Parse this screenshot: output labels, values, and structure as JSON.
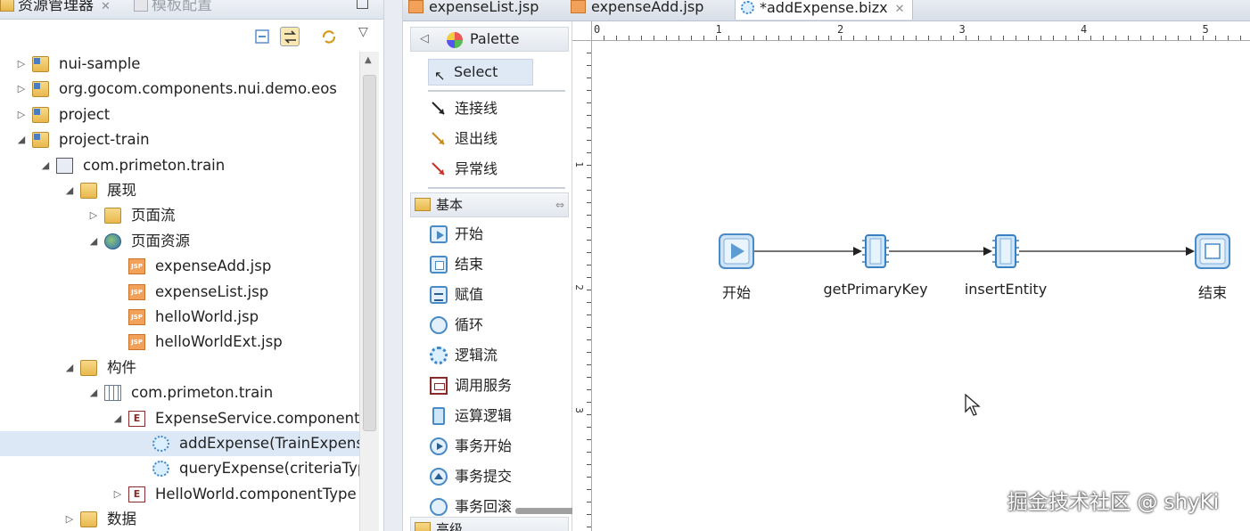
{
  "explorer": {
    "tabs": [
      {
        "label": "资源管理器",
        "icon": "explorer-icon"
      },
      {
        "label": "模板配置",
        "icon": "template-icon"
      }
    ],
    "tree": [
      {
        "label": "nui-sample",
        "depth": 0,
        "twisty": "collapsed",
        "icon": "project-icon"
      },
      {
        "label": "org.gocom.components.nui.demo.eos",
        "depth": 0,
        "twisty": "collapsed",
        "icon": "project-icon"
      },
      {
        "label": "project",
        "depth": 0,
        "twisty": "collapsed",
        "icon": "project-icon"
      },
      {
        "label": "project-train",
        "depth": 0,
        "twisty": "expanded",
        "icon": "project-icon"
      },
      {
        "label": "com.primeton.train",
        "depth": 1,
        "twisty": "expanded",
        "icon": "package-icon"
      },
      {
        "label": "展现",
        "depth": 2,
        "twisty": "expanded",
        "icon": "folder-icon"
      },
      {
        "label": "页面流",
        "depth": 3,
        "twisty": "collapsed",
        "icon": "folder-icon"
      },
      {
        "label": "页面资源",
        "depth": 3,
        "twisty": "expanded",
        "icon": "globe-icon"
      },
      {
        "label": "expenseAdd.jsp",
        "depth": 4,
        "twisty": "none",
        "icon": "jsp-icon"
      },
      {
        "label": "expenseList.jsp",
        "depth": 4,
        "twisty": "none",
        "icon": "jsp-icon"
      },
      {
        "label": "helloWorld.jsp",
        "depth": 4,
        "twisty": "none",
        "icon": "jsp-icon"
      },
      {
        "label": "helloWorldExt.jsp",
        "depth": 4,
        "twisty": "none",
        "icon": "jsp-icon"
      },
      {
        "label": "构件",
        "depth": 2,
        "twisty": "expanded",
        "icon": "folder-icon"
      },
      {
        "label": "com.primeton.train",
        "depth": 3,
        "twisty": "expanded",
        "icon": "grid-icon"
      },
      {
        "label": "ExpenseService.componentT",
        "depth": 4,
        "twisty": "expanded",
        "icon": "component-icon"
      },
      {
        "label": "addExpense(TrainExpens",
        "depth": 5,
        "twisty": "none",
        "icon": "logic-flow-icon",
        "selected": true
      },
      {
        "label": "queryExpense(criteriaTyp",
        "depth": 5,
        "twisty": "none",
        "icon": "logic-flow-icon"
      },
      {
        "label": "HelloWorld.componentType",
        "depth": 4,
        "twisty": "collapsed",
        "icon": "component-icon"
      },
      {
        "label": "数据",
        "depth": 2,
        "twisty": "collapsed",
        "icon": "folder-icon"
      }
    ]
  },
  "editor": {
    "tabs": [
      {
        "label": "expenseList.jsp",
        "active": false
      },
      {
        "label": "expenseAdd.jsp",
        "active": false
      },
      {
        "label": "*addExpense.bizx",
        "active": true
      }
    ]
  },
  "palette": {
    "title": "Palette",
    "select_label": "Select",
    "lines": [
      {
        "label": "连接线",
        "icon": "connection-line-icon"
      },
      {
        "label": "退出线",
        "icon": "exit-line-icon"
      },
      {
        "label": "异常线",
        "icon": "exception-line-icon"
      }
    ],
    "basic_group": "基本",
    "basic_items": [
      {
        "label": "开始",
        "icon": "start-node-icon"
      },
      {
        "label": "结束",
        "icon": "end-node-icon"
      },
      {
        "label": "赋值",
        "icon": "assign-icon"
      },
      {
        "label": "循环",
        "icon": "loop-icon"
      },
      {
        "label": "逻辑流",
        "icon": "logic-flow-icon"
      },
      {
        "label": "调用服务",
        "icon": "invoke-service-icon"
      },
      {
        "label": "运算逻辑",
        "icon": "operation-logic-icon"
      },
      {
        "label": "事务开始",
        "icon": "transaction-begin-icon"
      },
      {
        "label": "事务提交",
        "icon": "transaction-commit-icon"
      },
      {
        "label": "事务回滚",
        "icon": "transaction-rollback-icon"
      }
    ],
    "advanced_group": "高级"
  },
  "canvas": {
    "ruler_top": [
      "0",
      "1",
      "2",
      "3",
      "4",
      "5"
    ],
    "ruler_left": [
      "1",
      "2",
      "3"
    ],
    "nodes": [
      {
        "label": "开始",
        "type": "start"
      },
      {
        "label": "getPrimaryKey",
        "type": "operation"
      },
      {
        "label": "insertEntity",
        "type": "operation"
      },
      {
        "label": "结束",
        "type": "end"
      }
    ],
    "watermark": "掘金技术社区 @ shyKi"
  }
}
